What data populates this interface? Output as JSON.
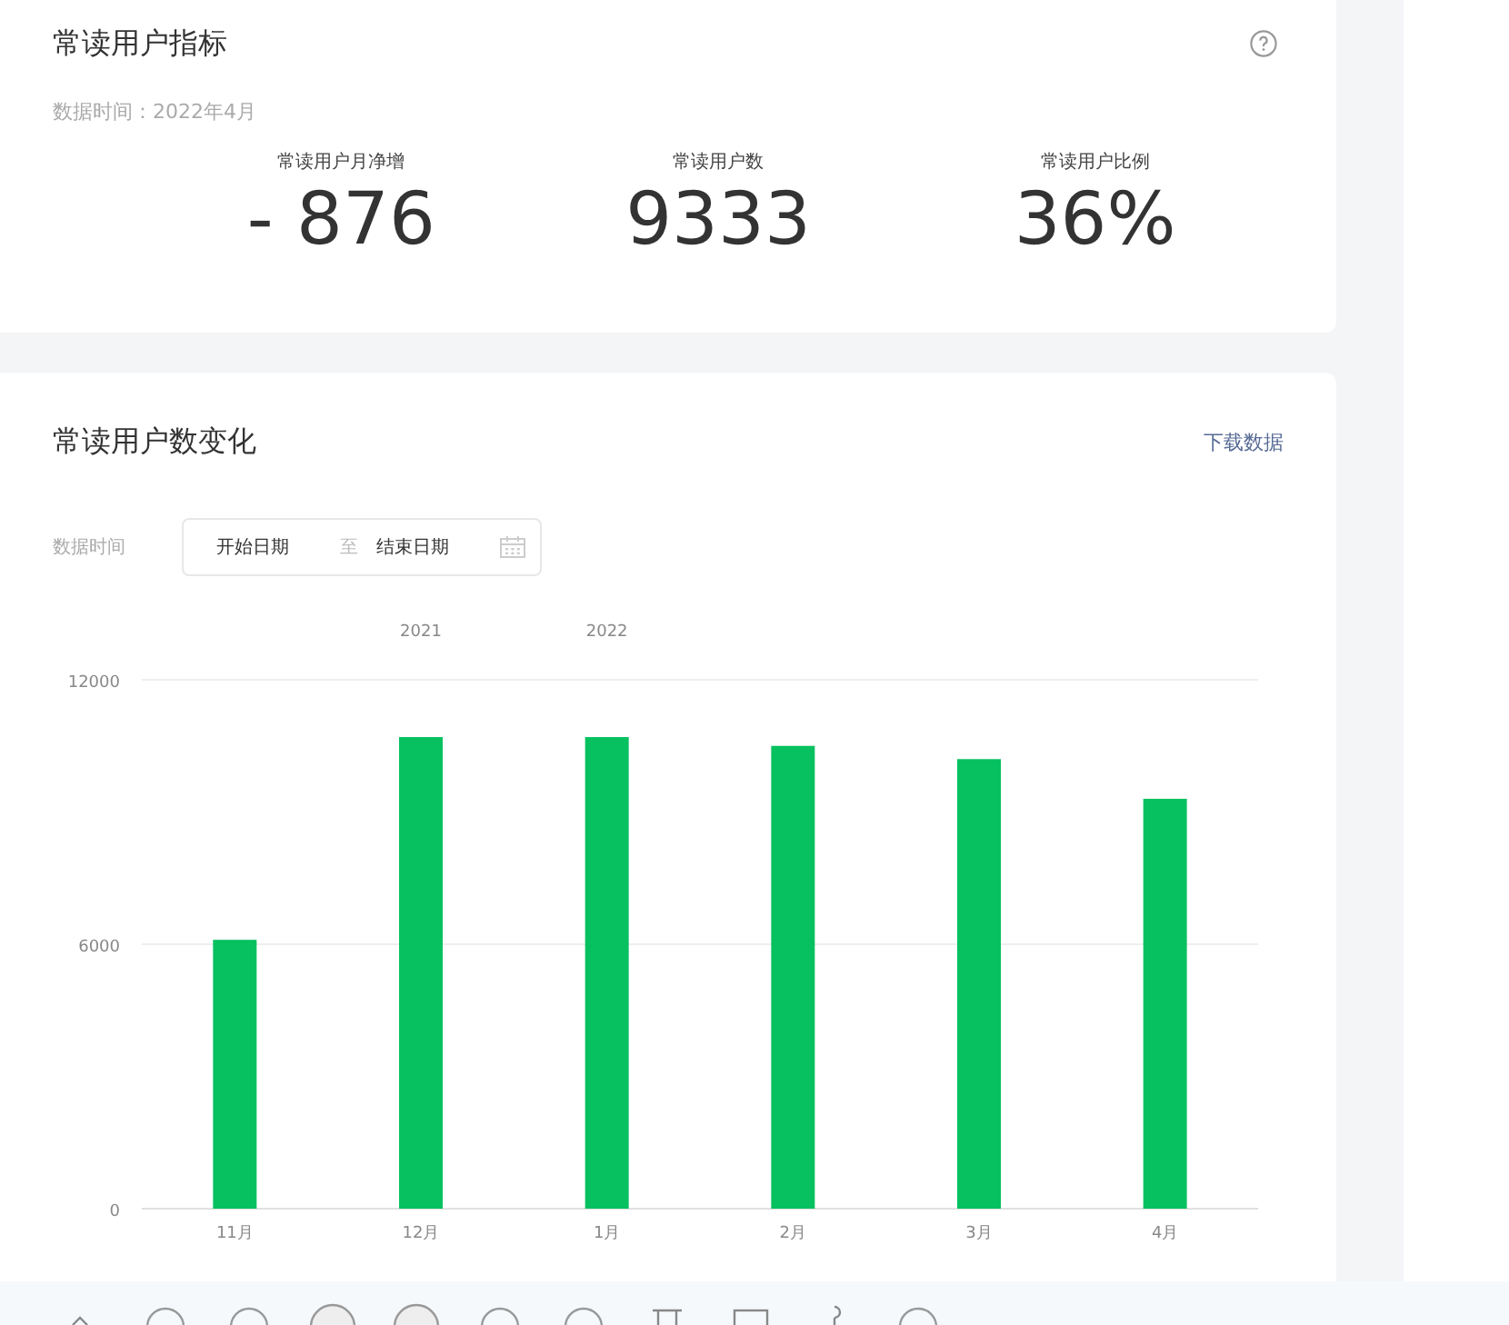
{
  "metrics_card": {
    "title": "常读用户指标",
    "data_time": "数据时间：2022年4月",
    "metrics": [
      {
        "label": "常读用户月净增",
        "value": "- 876"
      },
      {
        "label": "常读用户数",
        "value": "9333"
      },
      {
        "label": "常读用户比例",
        "value": "36%"
      }
    ]
  },
  "trend_card": {
    "title": "常读用户数变化",
    "download_link": "下载数据",
    "filter_label": "数据时间",
    "date_range": {
      "start_placeholder": "开始日期",
      "separator": "至",
      "end_placeholder": "结束日期"
    },
    "chart_data": {
      "type": "bar",
      "categories": [
        "11月",
        "12月",
        "1月",
        "2月",
        "3月",
        "4月"
      ],
      "series": [
        {
          "color": "#07c160",
          "values": [
            6100,
            10700,
            10700,
            10500,
            10200,
            9300
          ]
        }
      ],
      "ylim": [
        0,
        12000
      ],
      "yticks": [
        0,
        6000,
        12000
      ],
      "annotations": [
        "2021",
        "2022"
      ]
    }
  }
}
